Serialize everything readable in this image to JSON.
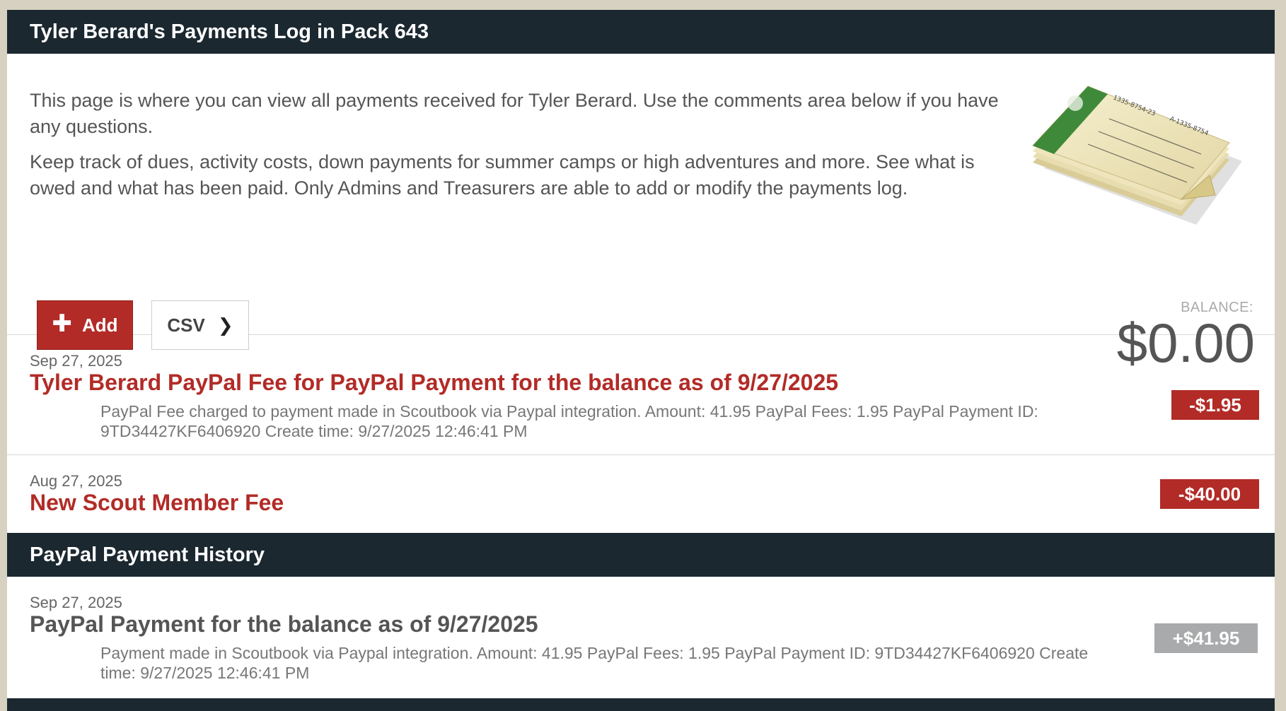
{
  "header": {
    "title": "Tyler Berard's Payments Log in Pack 643"
  },
  "intro": {
    "paragraph1": "This page is where you can view all payments received for Tyler Berard. Use the comments area below if you have any questions.",
    "paragraph2": "Keep track of dues, activity costs, down payments for summer camps or high adventures and more. See what is owed and what has been paid. Only Admins and Treasurers are able to add or modify the payments log."
  },
  "toolbar": {
    "add_label": "Add",
    "csv_label": "CSV"
  },
  "balance": {
    "label": "BALANCE:",
    "value": "$0.00"
  },
  "entries": [
    {
      "date": "Sep 27, 2025",
      "title": "Tyler Berard PayPal Fee for PayPal Payment for the balance as of 9/27/2025",
      "description": "PayPal Fee charged to payment made in Scoutbook via Paypal integration. Amount: 41.95 PayPal Fees: 1.95 PayPal Payment ID: 9TD34427KF6406920 Create time: 9/27/2025 12:46:41 PM",
      "amount": "-$1.95"
    },
    {
      "date": "Aug 27, 2025",
      "title": "New Scout Member Fee",
      "description": "",
      "amount": "-$40.00"
    }
  ],
  "paypal_history": {
    "title": "PayPal Payment History",
    "entries": [
      {
        "date": "Sep 27, 2025",
        "title": "PayPal Payment for the balance as of 9/27/2025",
        "description": "Payment made in Scoutbook via Paypal integration. Amount: 41.95 PayPal Fees: 1.95 PayPal Payment ID: 9TD34427KF6406920 Create time: 9/27/2025 12:46:41 PM",
        "amount": "+$41.95"
      }
    ]
  },
  "colors": {
    "header_bg": "#1b2830",
    "negative": "#b22b27",
    "positive": "#a8aaab",
    "page_bg": "#d6d1c0"
  }
}
